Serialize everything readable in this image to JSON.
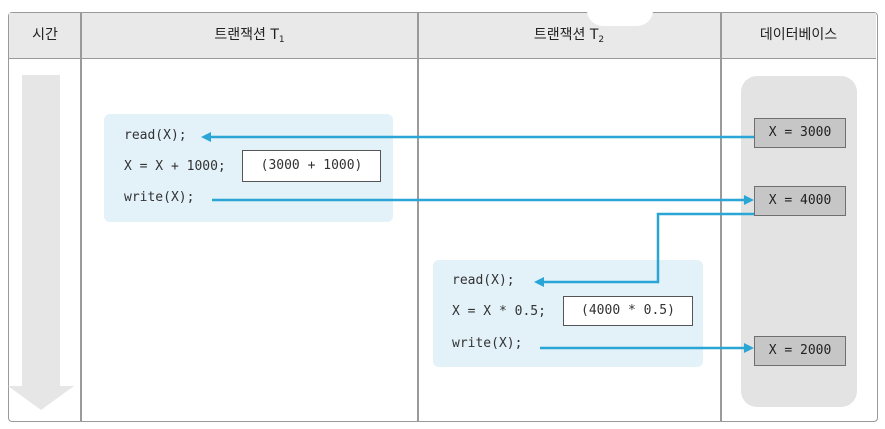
{
  "header": {
    "time": "시간",
    "t1_label": "트랜잭션 T",
    "t1_sub": "1",
    "t2_label": "트랜잭션 T",
    "t2_sub": "2",
    "db": "데이터베이스"
  },
  "t1": {
    "line1": "read(X);",
    "line2": "X = X + 1000;",
    "line3": "write(X);",
    "calc": "(3000 + 1000)"
  },
  "t2": {
    "line1": "read(X);",
    "line2": "X = X * 0.5;",
    "line3": "write(X);",
    "calc": "(4000 * 0.5)"
  },
  "db": {
    "v1": "X = 3000",
    "v2": "X = 4000",
    "v3": "X = 2000"
  },
  "colors": {
    "arrow": "#2aa6d6",
    "tx_bg": "#e3f1f9",
    "db_panel": "#e3e3e3",
    "db_value": "#c6c6c6",
    "time_arrow": "#e6e6e6"
  }
}
